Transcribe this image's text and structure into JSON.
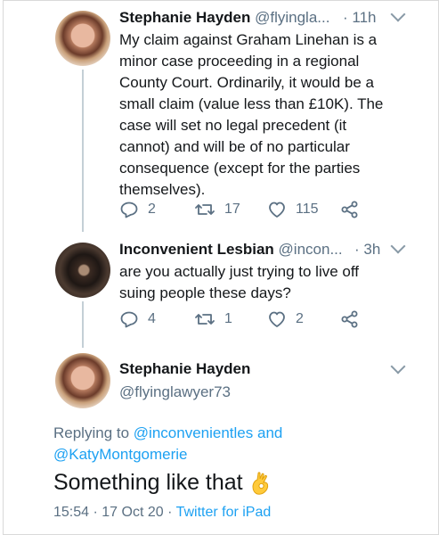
{
  "tweet1": {
    "display_name": "Stephanie Hayden",
    "handle": "@flyingla...",
    "time": "· 11h",
    "text": "My claim against Graham Linehan is a minor case proceeding in a regional County Court. Ordinarily, it would be a small claim (value less than £10K). The case will set no legal precedent (it cannot) and will be of no particular consequence (except for the parties themselves).",
    "replies": "2",
    "retweets": "17",
    "likes": "115"
  },
  "tweet2": {
    "display_name": "Inconvenient Lesbian",
    "handle": "@incon...",
    "time": "· 3h",
    "text": "are you actually just trying to live off suing people these days?",
    "replies": "4",
    "retweets": "1",
    "likes": "2"
  },
  "tweet3": {
    "display_name": "Stephanie Hayden",
    "handle": "@flyinglawyer73",
    "replying_prefix": "Replying to",
    "replying_user1": "@inconvenientles",
    "replying_and": "and",
    "replying_user2": "@KatyMontgomerie",
    "text": "Something like that",
    "timestamp": "15:54 · 17 Oct 20 ·",
    "source": "Twitter for iPad"
  },
  "colors": {
    "link": "#1da1f2",
    "secondary_text": "#5b7083",
    "primary_text": "#14171a",
    "thread_line": "#c4cfd6"
  },
  "icons": [
    "reply-icon",
    "retweet-icon",
    "like-icon",
    "share-icon",
    "chevron-down-icon",
    "ok-hand-emoji"
  ]
}
